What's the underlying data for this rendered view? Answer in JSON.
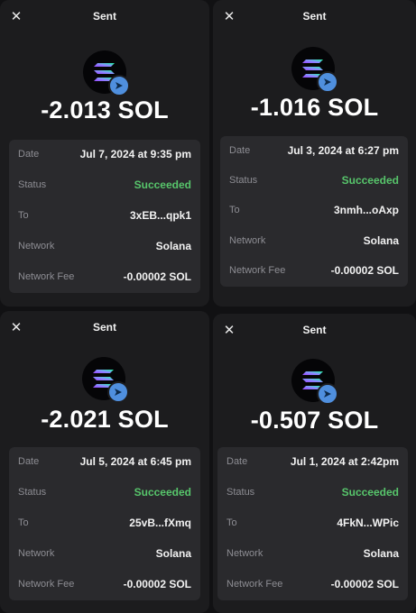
{
  "panels": [
    {
      "title": "Sent",
      "amount": "-2.013 SOL",
      "rows": [
        {
          "label": "Date",
          "value": "Jul 7, 2024 at 9:35 pm"
        },
        {
          "label": "Status",
          "value": "Succeeded"
        },
        {
          "label": "To",
          "value": "3xEB...qpk1"
        },
        {
          "label": "Network",
          "value": "Solana"
        },
        {
          "label": "Network Fee",
          "value": "-0.00002 SOL"
        }
      ]
    },
    {
      "title": "Sent",
      "amount": "-1.016 SOL",
      "rows": [
        {
          "label": "Date",
          "value": "Jul 3, 2024 at 6:27 pm"
        },
        {
          "label": "Status",
          "value": "Succeeded"
        },
        {
          "label": "To",
          "value": "3nmh...oAxp"
        },
        {
          "label": "Network",
          "value": "Solana"
        },
        {
          "label": "Network Fee",
          "value": "-0.00002 SOL"
        }
      ]
    },
    {
      "title": "Sent",
      "amount": "-2.021 SOL",
      "rows": [
        {
          "label": "Date",
          "value": "Jul 5, 2024 at 6:45 pm"
        },
        {
          "label": "Status",
          "value": "Succeeded"
        },
        {
          "label": "To",
          "value": "25vB...fXmq"
        },
        {
          "label": "Network",
          "value": "Solana"
        },
        {
          "label": "Network Fee",
          "value": "-0.00002 SOL"
        }
      ]
    },
    {
      "title": "Sent",
      "amount": "-0.507 SOL",
      "rows": [
        {
          "label": "Date",
          "value": "Jul 1, 2024 at 2:42pm"
        },
        {
          "label": "Status",
          "value": "Succeeded"
        },
        {
          "label": "To",
          "value": "4FkN...WPic"
        },
        {
          "label": "Network",
          "value": "Solana"
        },
        {
          "label": "Network Fee",
          "value": "-0.00002 SOL"
        }
      ]
    }
  ],
  "icons": {
    "close": "close-icon",
    "token": "solana-logo-icon",
    "badge": "send-arrow-icon"
  },
  "colors": {
    "background": "#111113",
    "panel": "#1c1c1e",
    "card": "#2a2a2d",
    "label": "#8d8d93",
    "success": "#57c56b",
    "badge": "#4f8fde"
  }
}
